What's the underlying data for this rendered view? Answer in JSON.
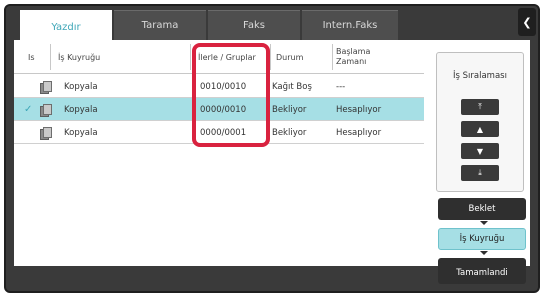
{
  "tabs": [
    {
      "label": "Yazdır",
      "active": true
    },
    {
      "label": "Tarama",
      "active": false
    },
    {
      "label": "Faks",
      "active": false
    },
    {
      "label": "Intern.Faks",
      "active": false
    }
  ],
  "back_icon": "chevron-left",
  "columns": {
    "status": "Is",
    "job_queue": "İş Kuyruğu",
    "progress": "İlerle / Gruplar",
    "state": "Durum",
    "start_time": "Başlama Zamanı"
  },
  "rows": [
    {
      "name": "Kopyala",
      "progress": "0010/0010",
      "state": "Kağıt Boş",
      "start": "---",
      "selected": false
    },
    {
      "name": "Kopyala",
      "progress": "0000/0010",
      "state": "Bekliyor",
      "start": "Hesaplıyor",
      "selected": true
    },
    {
      "name": "Kopyala",
      "progress": "0000/0001",
      "state": "Bekliyor",
      "start": "Hesaplıyor",
      "selected": false
    }
  ],
  "queue_order": {
    "title": "İş Sıralaması",
    "buttons": [
      "move-to-top",
      "move-up",
      "move-down",
      "move-to-bottom"
    ]
  },
  "side_buttons": {
    "hold": "Beklet",
    "job_queue": "İş Kuyruğu",
    "completed": "Tamamlandi"
  },
  "colors": {
    "accent": "#3fa7b8",
    "selected_row": "#a6dfe5",
    "highlight": "#d9223f",
    "frame": "#3a3a3a"
  }
}
